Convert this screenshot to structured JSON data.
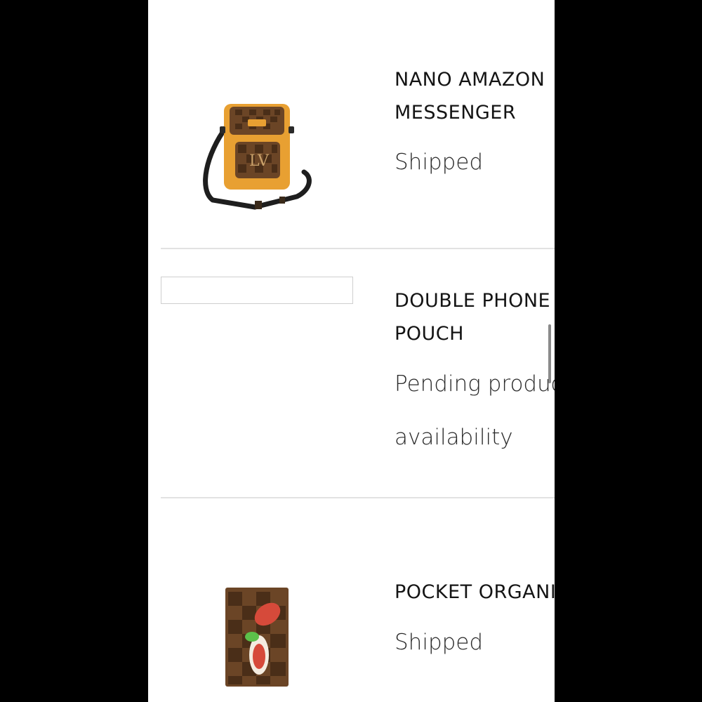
{
  "orders": {
    "items": [
      {
        "name": "NANO AMAZON\nMESSENGER",
        "status": "Shipped",
        "image_icon": "messenger-bag-image"
      },
      {
        "name": "DOUBLE PHONE\nPOUCH",
        "status": "Pending product\navailability",
        "image_icon": "image-placeholder"
      },
      {
        "name": "POCKET ORGANIZER",
        "status": "Shipped",
        "image_icon": "pocket-organizer-image"
      }
    ]
  },
  "colors": {
    "letterbox": "#000000",
    "page_background": "#ffffff",
    "text": "#141414",
    "divider": "#e2e2e2",
    "canvas_brown": "#6b4526",
    "leather_tan": "#e8a032"
  }
}
